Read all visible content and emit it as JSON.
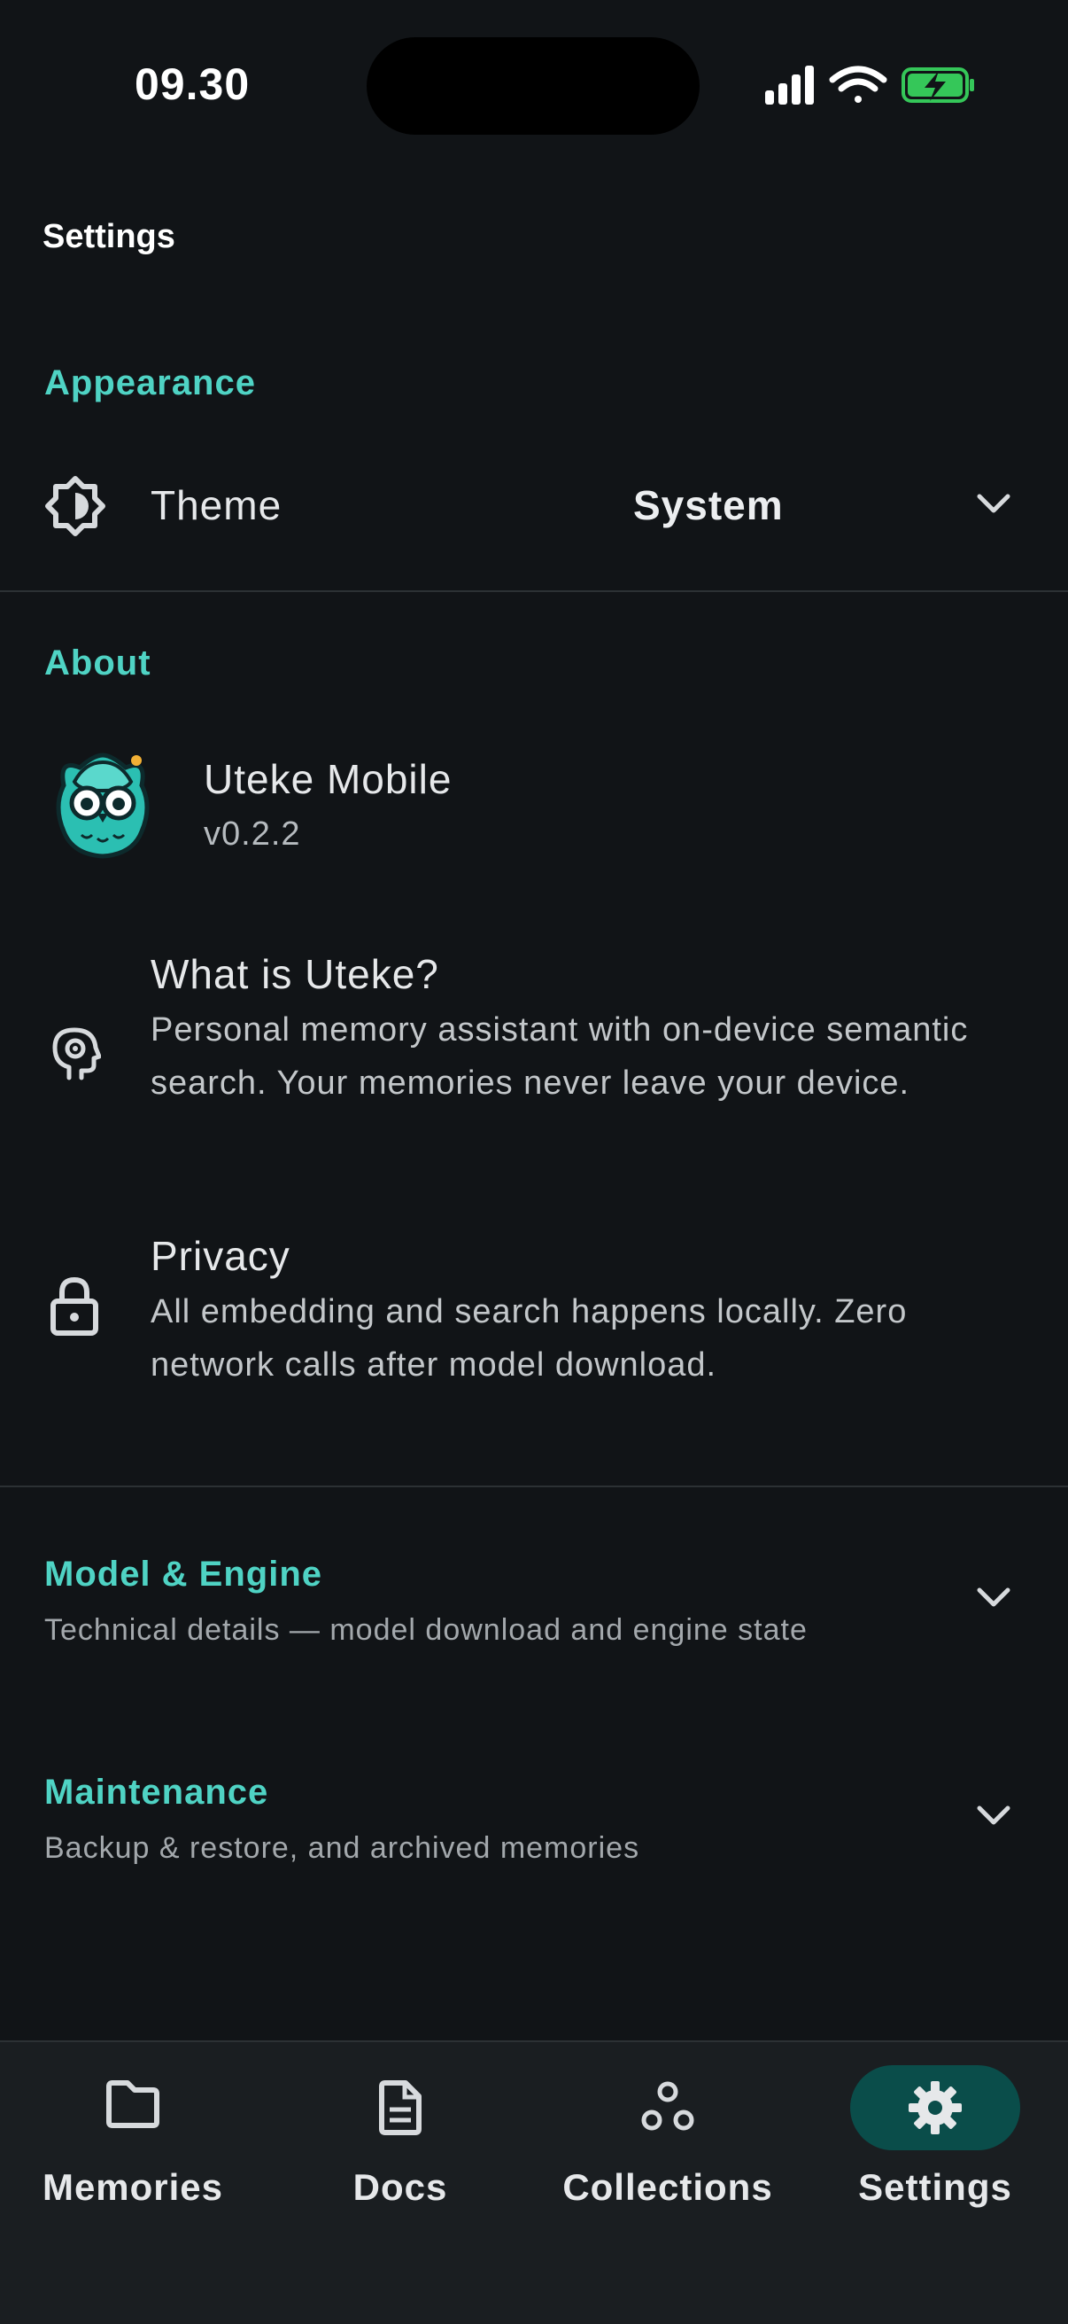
{
  "status_bar": {
    "time": "09.30"
  },
  "header": {
    "title": "Settings"
  },
  "appearance": {
    "section_title": "Appearance",
    "theme_label": "Theme",
    "theme_value": "System"
  },
  "about": {
    "section_title": "About",
    "app_name": "Uteke Mobile",
    "app_version": "v0.2.2",
    "what_title": "What is Uteke?",
    "what_desc": "Personal memory assistant with on-device semantic search. Your memories never leave your device.",
    "privacy_title": "Privacy",
    "privacy_desc": "All embedding and search happens locally. Zero network calls after model download."
  },
  "model_engine": {
    "section_title": "Model & Engine",
    "desc": "Technical details — model download and engine state"
  },
  "maintenance": {
    "section_title": "Maintenance",
    "desc": "Backup & restore, and archived memories"
  },
  "nav": {
    "items": [
      {
        "label": "Memories",
        "icon": "folder-icon"
      },
      {
        "label": "Docs",
        "icon": "document-icon"
      },
      {
        "label": "Collections",
        "icon": "collections-icon"
      },
      {
        "label": "Settings",
        "icon": "gear-icon",
        "active": true
      }
    ]
  },
  "colors": {
    "background": "#111417",
    "accent": "#4fd3c4",
    "nav_active_pill": "#0a4d4a",
    "battery_green": "#35c759"
  }
}
